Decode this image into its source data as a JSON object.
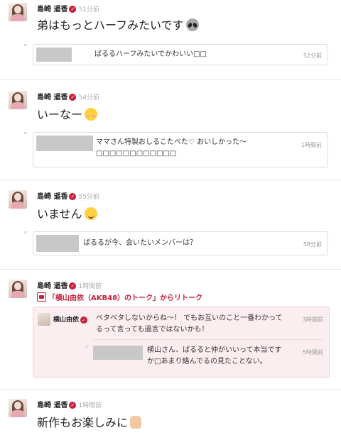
{
  "posts": [
    {
      "author": "島崎 遥香",
      "time": "51分前",
      "message": "弟はもっとハーフみたいです",
      "emoji": "alien-face-icon",
      "quote": {
        "text": "ぱるるハーフみたいでかわいい□□",
        "time": "52分前"
      }
    },
    {
      "author": "島崎 遥香",
      "time": "54分前",
      "message": "いーなー",
      "emoji": "blushing-face-icon",
      "quote": {
        "text": "ママさん特製おしるこたべた♡ おいしかった〜□□□□□□□□□□□□",
        "time": "1時間前"
      }
    },
    {
      "author": "島崎 遥香",
      "time": "55分前",
      "message": "いません",
      "emoji": "smiling-face-icon",
      "quote": {
        "text": "ぱるるが今、会いたいメンバーは？",
        "time": "58分前"
      }
    },
    {
      "author": "島崎 遥香",
      "time": "1時間前",
      "retalk_link": "「横山由依（AKB48）のトーク」からリトーク",
      "retalk": {
        "author": "横山由依",
        "text": "ベタベタしないからね〜！ でもお互いのこと一番わかってるって言っても過言ではないかも！",
        "time": "3時間前",
        "sub_quote": {
          "text": "横山さん、ぱるると仲がいいって本当ですか□あまり絡んでるの見たことない。",
          "time": "5時間前"
        }
      }
    },
    {
      "author": "島崎 遥香",
      "time": "1時間前",
      "message": "新作もお楽しみに",
      "emoji": "thumbs-up-icon"
    }
  ]
}
